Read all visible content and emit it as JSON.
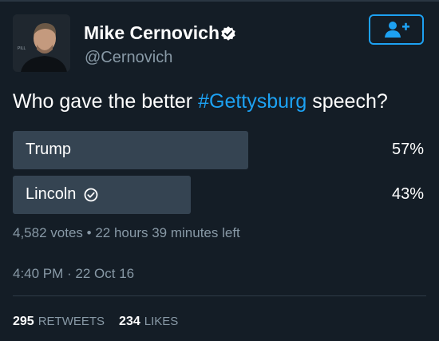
{
  "colors": {
    "background": "#141d26",
    "accent": "#1da1f2",
    "secondary_text": "#8899a6",
    "poll_bar": "#354452"
  },
  "profile": {
    "display_name": "Mike Cernovich",
    "handle": "@Cernovich",
    "avatar_icon": "user-photo-avatar",
    "verified_icon": "verified-badge-icon",
    "follow_icon": "add-user-icon"
  },
  "tweet": {
    "text_before": "Who gave the better ",
    "hashtag": "#Gettysburg",
    "text_after": " speech?"
  },
  "poll": {
    "options": [
      {
        "label": "Trump",
        "percent_text": "57%",
        "fraction": 0.57,
        "selected": false
      },
      {
        "label": "Lincoln",
        "percent_text": "43%",
        "fraction": 0.43,
        "selected": true
      }
    ],
    "votes": "4,582 votes",
    "separator": "•",
    "time_left": "22 hours 39 minutes left"
  },
  "timestamp": "4:40 PM · 22 Oct 16",
  "stats": {
    "retweets_count": "295",
    "retweets_label": "RETWEETS",
    "likes_count": "234",
    "likes_label": "LIKES"
  }
}
